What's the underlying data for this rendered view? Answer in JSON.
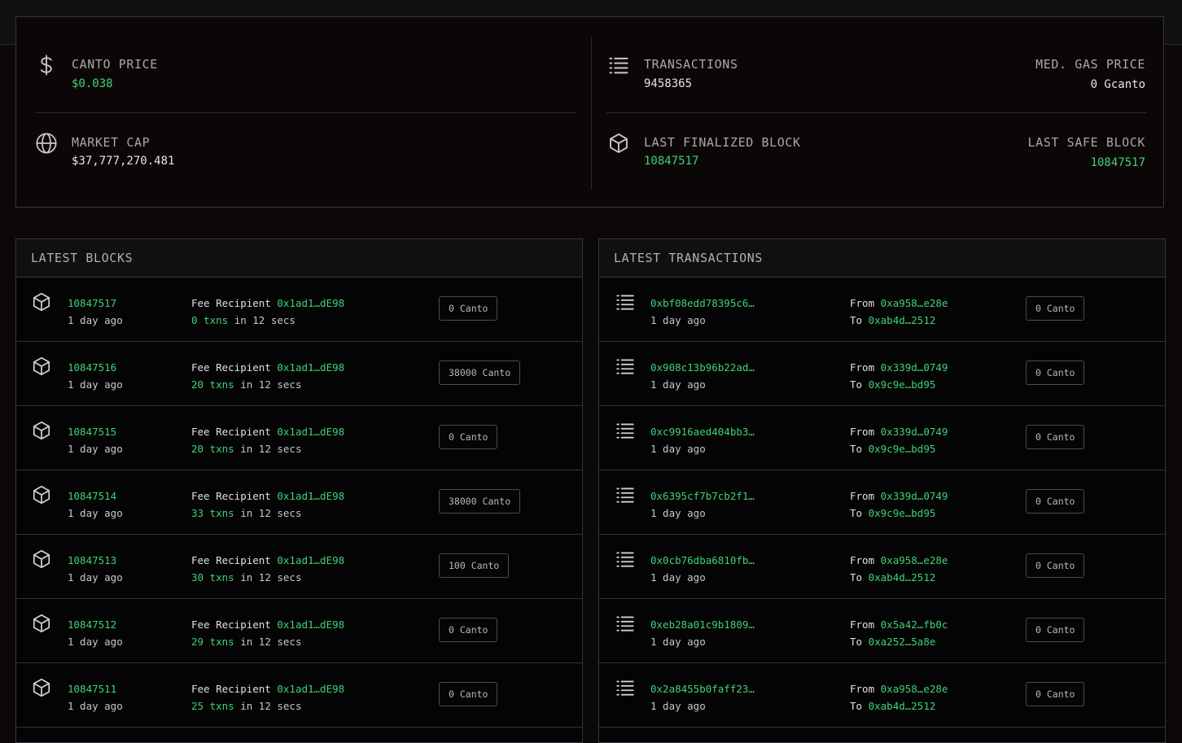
{
  "stats": {
    "canto_price_label": "CANTO PRICE",
    "canto_price_value": "$0.038",
    "market_cap_label": "MARKET CAP",
    "market_cap_value": "$37,777,270.481",
    "transactions_label": "TRANSACTIONS",
    "transactions_value": "9458365",
    "gas_label": "MED. GAS PRICE",
    "gas_value": "0 Gcanto",
    "finalized_label": "LAST FINALIZED BLOCK",
    "finalized_value": "10847517",
    "safe_label": "LAST SAFE BLOCK",
    "safe_value": "10847517"
  },
  "blocks": {
    "title": "LATEST BLOCKS",
    "fee_recipient_label": "Fee Recipient",
    "rows": [
      {
        "number": "10847517",
        "age": "1 day ago",
        "recipient": "0x1ad1…dE98",
        "txns": "0 txns",
        "duration": "in 12 secs",
        "reward": "0 Canto"
      },
      {
        "number": "10847516",
        "age": "1 day ago",
        "recipient": "0x1ad1…dE98",
        "txns": "20 txns",
        "duration": "in 12 secs",
        "reward": "38000 Canto"
      },
      {
        "number": "10847515",
        "age": "1 day ago",
        "recipient": "0x1ad1…dE98",
        "txns": "20 txns",
        "duration": "in 12 secs",
        "reward": "0 Canto"
      },
      {
        "number": "10847514",
        "age": "1 day ago",
        "recipient": "0x1ad1…dE98",
        "txns": "33 txns",
        "duration": "in 12 secs",
        "reward": "38000 Canto"
      },
      {
        "number": "10847513",
        "age": "1 day ago",
        "recipient": "0x1ad1…dE98",
        "txns": "30 txns",
        "duration": "in 12 secs",
        "reward": "100 Canto"
      },
      {
        "number": "10847512",
        "age": "1 day ago",
        "recipient": "0x1ad1…dE98",
        "txns": "29 txns",
        "duration": "in 12 secs",
        "reward": "0 Canto"
      },
      {
        "number": "10847511",
        "age": "1 day ago",
        "recipient": "0x1ad1…dE98",
        "txns": "25 txns",
        "duration": "in 12 secs",
        "reward": "0 Canto"
      }
    ]
  },
  "transactions": {
    "title": "LATEST TRANSACTIONS",
    "from_label": "From",
    "to_label": "To",
    "rows": [
      {
        "hash": "0xbf08edd78395c6…",
        "age": "1 day ago",
        "from": "0xa958…e28e",
        "to": "0xab4d…2512",
        "value": "0 Canto"
      },
      {
        "hash": "0x908c13b96b22ad…",
        "age": "1 day ago",
        "from": "0x339d…0749",
        "to": "0x9c9e…bd95",
        "value": "0 Canto"
      },
      {
        "hash": "0xc9916aed404bb3…",
        "age": "1 day ago",
        "from": "0x339d…0749",
        "to": "0x9c9e…bd95",
        "value": "0 Canto"
      },
      {
        "hash": "0x6395cf7b7cb2f1…",
        "age": "1 day ago",
        "from": "0x339d…0749",
        "to": "0x9c9e…bd95",
        "value": "0 Canto"
      },
      {
        "hash": "0x0cb76dba6810fb…",
        "age": "1 day ago",
        "from": "0xa958…e28e",
        "to": "0xab4d…2512",
        "value": "0 Canto"
      },
      {
        "hash": "0xeb28a01c9b1809…",
        "age": "1 day ago",
        "from": "0x5a42…fb0c",
        "to": "0xa252…5a8e",
        "value": "0 Canto"
      },
      {
        "hash": "0x2a8455b0faff23…",
        "age": "1 day ago",
        "from": "0xa958…e28e",
        "to": "0xab4d…2512",
        "value": "0 Canto"
      }
    ]
  },
  "icons": {
    "price": "dollar-icon",
    "market_cap": "globe-icon",
    "transactions": "list-icon",
    "block": "cube-icon"
  },
  "colors": {
    "accent_green": "#3fd27a",
    "background": "#0d0808",
    "border": "#35373a"
  }
}
